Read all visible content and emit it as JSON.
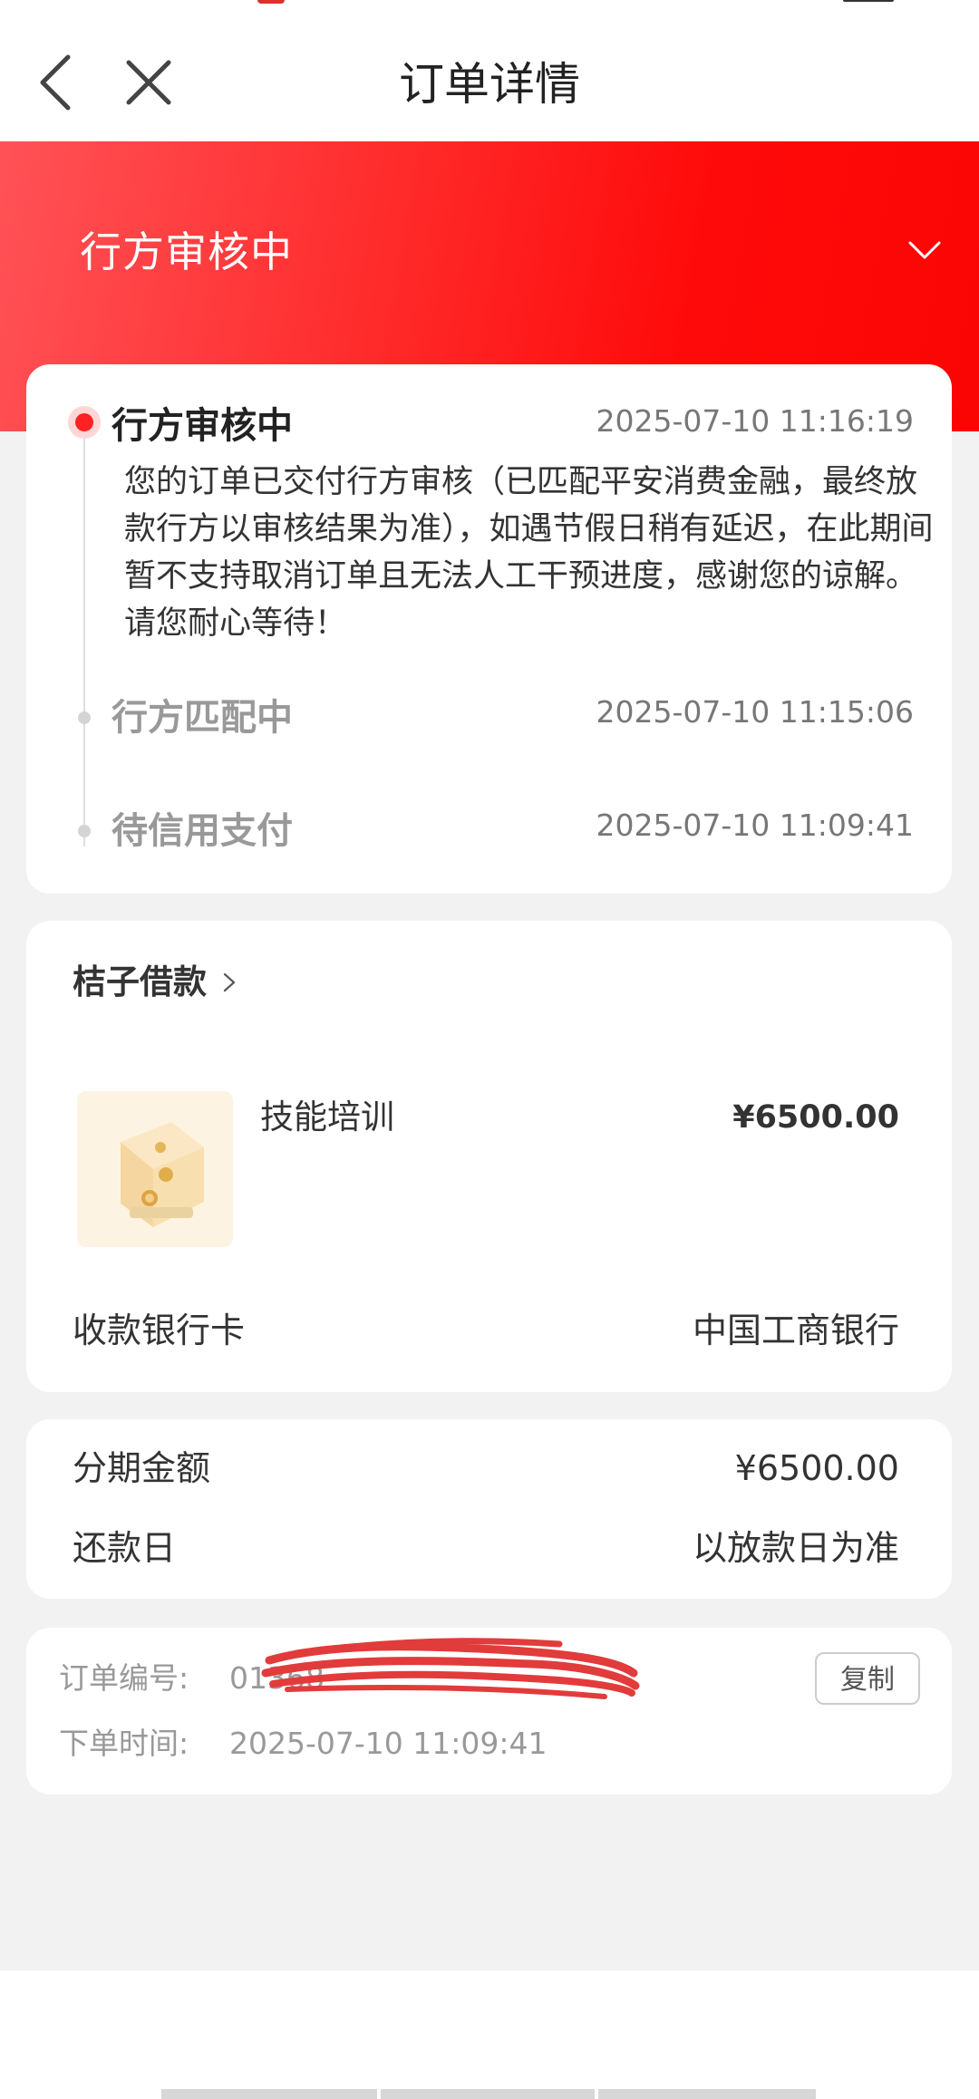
{
  "header": {
    "title": "订单详情",
    "back_icon": "chevron-left-icon",
    "close_icon": "close-icon"
  },
  "banner": {
    "status": "行方审核中",
    "chevron_icon": "chevron-down-icon",
    "gradient_colors": [
      "#ff5257",
      "#fb0404"
    ]
  },
  "timeline": {
    "active_color": "#ff2222",
    "steps": [
      {
        "title": "行方审核中",
        "time": "2025-07-10 11:16:19",
        "description": "您的订单已交付行方审核（已匹配平安消费金融，最终放款行方以审核结果为准），如遇节假日稍有延迟，在此期间暂不支持取消订单且无法人工干预进度，感谢您的谅解。请您耐心等待！"
      },
      {
        "title": "行方匹配中",
        "time": "2025-07-10 11:15:06"
      },
      {
        "title": "待信用支付",
        "time": "2025-07-10 11:09:41"
      }
    ]
  },
  "product": {
    "merchant": "桔子借款",
    "name": "技能培训",
    "price": "¥6500.00",
    "bank_label": "收款银行卡",
    "bank_value": "中国工商银行"
  },
  "installment": {
    "amount_label": "分期金额",
    "amount_value": "¥6500.00",
    "repay_label": "还款日",
    "repay_value": "以放款日为准"
  },
  "order": {
    "number_label": "订单编号:",
    "number_value": "01368",
    "copy_label": "复制",
    "time_label": "下单时间:",
    "time_value": "2025-07-10 11:09:41"
  }
}
